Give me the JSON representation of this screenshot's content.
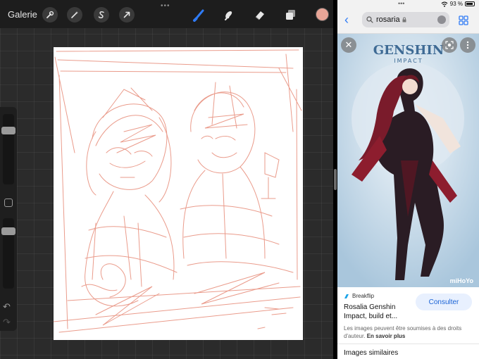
{
  "procreate": {
    "gallery_label": "Galerie",
    "tools_left": [
      "wrench-icon",
      "magic-wand-icon",
      "selection-s-icon",
      "transform-arrow-icon"
    ],
    "tools_right": [
      "brush-icon",
      "smudge-icon",
      "eraser-icon",
      "layers-icon"
    ],
    "active_tool": "brush-icon",
    "current_color": "#e8a597",
    "sketch_color": "#e8917f",
    "brush_size_level": 0.8,
    "opacity_level": 0.85
  },
  "status_bar": {
    "battery_percent": "93 %",
    "battery_level": 0.93
  },
  "safari": {
    "search_query": "rosaria",
    "accent_color": "#2f7bf5"
  },
  "image_viewer": {
    "logo_text": "GENSHIN",
    "logo_subtext": "IMPACT",
    "publisher_mark": "miHoYo"
  },
  "result": {
    "source_name": "Breakflip",
    "title": "Rosalia Genshin Impact, build et...",
    "visit_label": "Consulter",
    "copyright_notice": "Les images peuvent être soumises à des droits d'auteur.",
    "learn_more_label": "En savoir plus",
    "similar_heading": "Images similaires"
  }
}
